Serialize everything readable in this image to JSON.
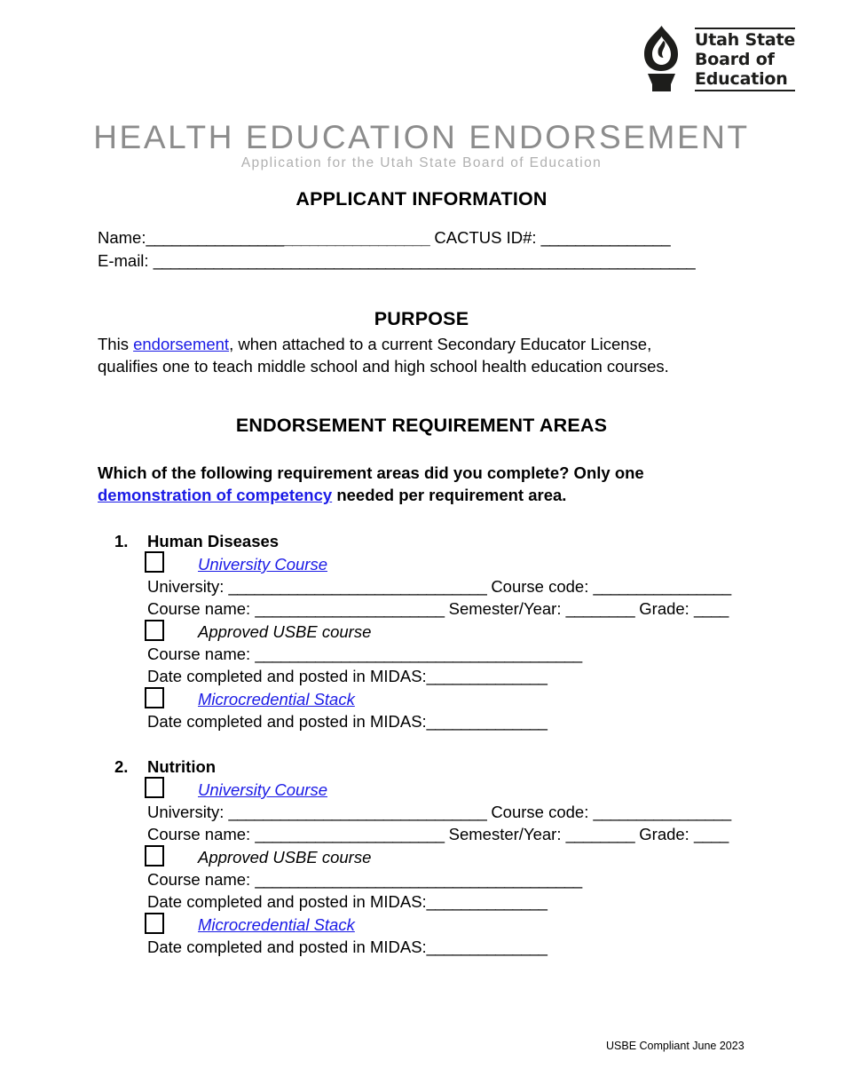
{
  "logo": {
    "icon": "torch-flame-icon",
    "line1": "Utah State",
    "line2": "Board of",
    "line3": "Education"
  },
  "title": "HEALTH EDUCATION ENDORSEMENT",
  "subtitle": "Application for the Utah State Board of Education",
  "applicant": {
    "heading": "APPLICANT INFORMATION",
    "name_label": "Name:",
    "name_rule_a": "________________",
    "name_rule_b": "_________________",
    "cactus_label": "CACTUS ID#:",
    "cactus_rule": "_______________",
    "email_label": "E-mail:",
    "email_rule": "_______________________________________________________________"
  },
  "purpose": {
    "heading": "PURPOSE",
    "line1_pre": "This ",
    "line1_link": "endorsement",
    "line1_post": ", when attached to a current Secondary Educator License,",
    "line2": "qualifies one to teach middle school and high school health education courses."
  },
  "requirements": {
    "heading": "ENDORSEMENT REQUIREMENT AREAS",
    "prompt_line1": "Which of the following requirement areas did you complete? Only one",
    "prompt_link": "demonstration of competency",
    "prompt_line1_post": " needed per requirement area.",
    "labels": {
      "university_course": "University Course",
      "approved_usbe_course": "Approved USBE course",
      "microcredential_stack": "Microcredential Stack",
      "university": "University:",
      "course_code": "Course code:",
      "course_name": "Course name:",
      "semester_year": "Semester/Year:",
      "grade": "Grade:",
      "date_midas": "Date completed and posted in MIDAS:"
    },
    "rules": {
      "university": "______________________________",
      "course_code": "________________",
      "course_name_uni": "______________________",
      "semester_year": "________",
      "grade": "____",
      "course_name_usbe": "______________________________________",
      "midas": "______________"
    },
    "areas": [
      {
        "number": "1.",
        "name": "Human Diseases"
      },
      {
        "number": "2.",
        "name": "Nutrition"
      }
    ]
  },
  "footer": "USBE Compliant June 2023",
  "colors": {
    "link": "#1a1ae6",
    "title_gray": "#8c8c8c",
    "subtitle_gray": "#b0b0b0",
    "logo_black": "#1d1d1b"
  }
}
